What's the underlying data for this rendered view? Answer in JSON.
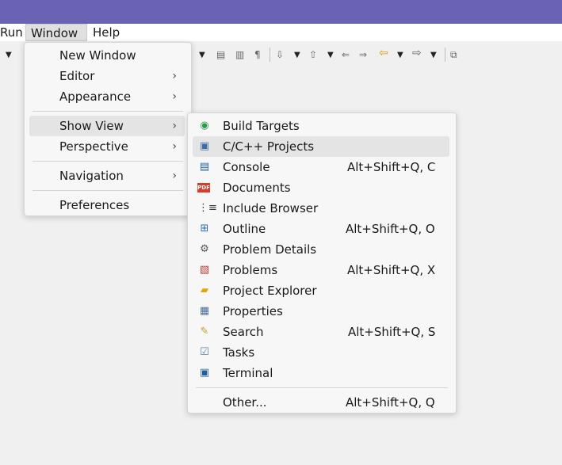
{
  "menubar": {
    "items": [
      "Run",
      "Window",
      "Help"
    ]
  },
  "window_menu": {
    "items": [
      {
        "label": "New Window"
      },
      {
        "label": "Editor"
      },
      {
        "label": "Appearance"
      },
      {
        "label": "Show View"
      },
      {
        "label": "Perspective"
      },
      {
        "label": "Navigation"
      },
      {
        "label": "Preferences"
      }
    ]
  },
  "show_view_menu": {
    "items": [
      {
        "label": "Build Targets",
        "shortcut": "",
        "icon": "build-targets-icon"
      },
      {
        "label": "C/C++ Projects",
        "shortcut": "",
        "icon": "cpp-projects-icon"
      },
      {
        "label": "Console",
        "shortcut": "Alt+Shift+Q, C",
        "icon": "console-icon"
      },
      {
        "label": "Documents",
        "shortcut": "",
        "icon": "pdf-documents-icon"
      },
      {
        "label": "Include Browser",
        "shortcut": "",
        "icon": "include-browser-icon"
      },
      {
        "label": "Outline",
        "shortcut": "Alt+Shift+Q, O",
        "icon": "outline-icon"
      },
      {
        "label": "Problem Details",
        "shortcut": "",
        "icon": "problem-details-icon"
      },
      {
        "label": "Problems",
        "shortcut": "Alt+Shift+Q, X",
        "icon": "problems-icon"
      },
      {
        "label": "Project Explorer",
        "shortcut": "",
        "icon": "project-explorer-icon"
      },
      {
        "label": "Properties",
        "shortcut": "",
        "icon": "properties-icon"
      },
      {
        "label": "Search",
        "shortcut": "Alt+Shift+Q, S",
        "icon": "search-icon"
      },
      {
        "label": "Tasks",
        "shortcut": "",
        "icon": "tasks-icon"
      },
      {
        "label": "Terminal",
        "shortcut": "",
        "icon": "terminal-icon"
      },
      {
        "label": "Other...",
        "shortcut": "Alt+Shift+Q, Q",
        "icon": ""
      }
    ]
  },
  "pdf_icon_text": "PDF"
}
